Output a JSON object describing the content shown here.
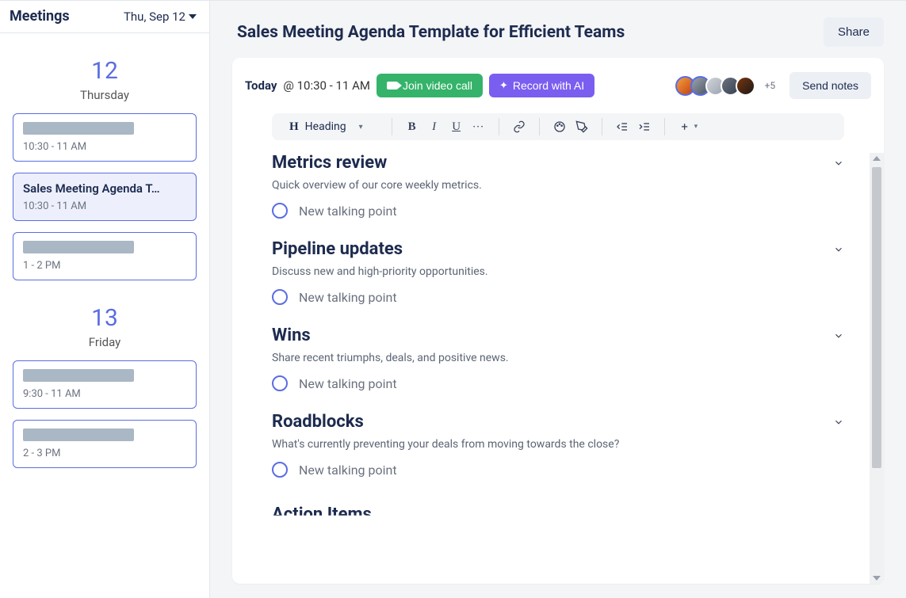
{
  "sidebar": {
    "title": "Meetings",
    "date_label": "Thu, Sep 12",
    "days": [
      {
        "number": "12",
        "name": "Thursday",
        "meetings": [
          {
            "title": "",
            "time": "10:30 - 11 AM",
            "placeholder": true,
            "selected": false
          },
          {
            "title": "Sales Meeting Agenda T…",
            "time": "10:30 - 11 AM",
            "placeholder": false,
            "selected": true
          },
          {
            "title": "",
            "time": "1 - 2 PM",
            "placeholder": true,
            "selected": false
          }
        ]
      },
      {
        "number": "13",
        "name": "Friday",
        "meetings": [
          {
            "title": "",
            "time": "9:30 - 11 AM",
            "placeholder": true,
            "selected": false
          },
          {
            "title": "",
            "time": "2 - 3 PM",
            "placeholder": true,
            "selected": false
          }
        ]
      }
    ]
  },
  "page": {
    "title": "Sales Meeting Agenda Template for Efficient Teams",
    "share_label": "Share"
  },
  "meeting_meta": {
    "today_label": "Today",
    "time_label": "@ 10:30 - 11 AM",
    "join_label": "Join video call",
    "record_label": "Record with AI",
    "more_avatars": "+5",
    "send_notes_label": "Send notes"
  },
  "toolbar": {
    "heading_label": "Heading"
  },
  "sections": [
    {
      "title": "Metrics review",
      "desc": "Quick overview of our core weekly metrics.",
      "placeholder": "New talking point"
    },
    {
      "title": "Pipeline updates",
      "desc": "Discuss new and high-priority opportunities.",
      "placeholder": "New talking point"
    },
    {
      "title": "Wins",
      "desc": "Share recent triumphs, deals, and positive news.",
      "placeholder": "New talking point"
    },
    {
      "title": "Roadblocks",
      "desc": "What's currently preventing your deals from moving towards the close?",
      "placeholder": "New talking point"
    }
  ],
  "cutoff_section": {
    "title": "Action Items"
  },
  "colors": {
    "accent": "#5b6de2",
    "green": "#35b36a",
    "purple": "#7a5ef0"
  }
}
